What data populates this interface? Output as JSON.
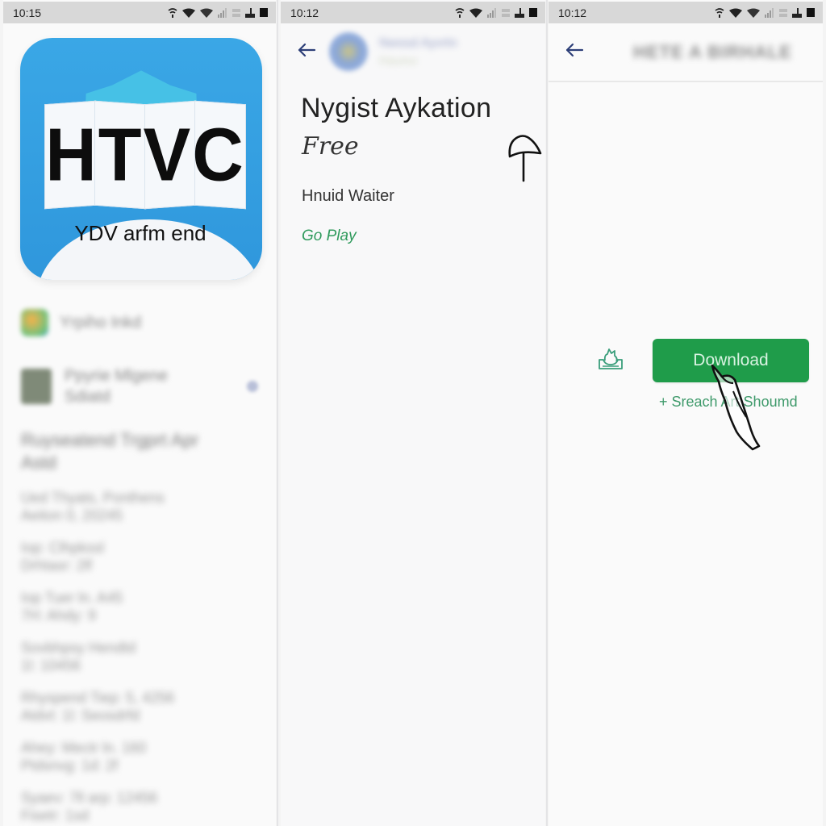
{
  "panels": [
    {
      "status_bar": {
        "time": "10:15"
      },
      "app_icon": {
        "letters": "HTVC",
        "caption": "YDV arfm end",
        "colors": {
          "background": "#2f97dc",
          "burst": "#46c1e6",
          "letters": "#0d0d0d"
        }
      },
      "blurred_list": {
        "row1_text": "Yrpiho Inkd",
        "row2_text_line1": "Ppyrie Mlgene",
        "row2_text_line2": "Sdiatd",
        "heading_line1": "Ruyseatend Trgprt Apr",
        "heading_line2": "Astd",
        "items": [
          [
            "Ued Thyats, Ponthens",
            "Aeiton 0, 20245"
          ],
          [
            "Iop: Clhpkssl",
            "Drhtasr: 2lf"
          ],
          [
            "Iop Tuer ln. A45",
            "7H: Ahdy: 9"
          ],
          [
            "Sovbhpsy Hendtd",
            "1l: 10456"
          ],
          [
            "Rhyspend Tiep: 5, 4256",
            "Atdvt: 1l: Seosdrfd"
          ],
          [
            "Ahey: Mectr ln. 160",
            "Ptdsnvg: 1d: 2f"
          ],
          [
            "Syaev: 7ll arp: 12456",
            "Fisetr: 1sd"
          ]
        ]
      }
    },
    {
      "status_bar": {
        "time": "10:12"
      },
      "header": {
        "blurred_title": "Nwssd Ayvrtn",
        "blurred_subtitle": "Pdsvhnr"
      },
      "app_title": "Nygist Aykation",
      "price": "Free",
      "developer": "Hnuid Waiter",
      "store_link": "Go Play"
    },
    {
      "status_bar": {
        "time": "10:12"
      },
      "header": {
        "blurred_title": "HETE A BIRHALE"
      },
      "download_button": {
        "label": "Download",
        "color": "#1f9c4a"
      },
      "secondary_link": "+ Sreach Art Shoumd"
    }
  ]
}
